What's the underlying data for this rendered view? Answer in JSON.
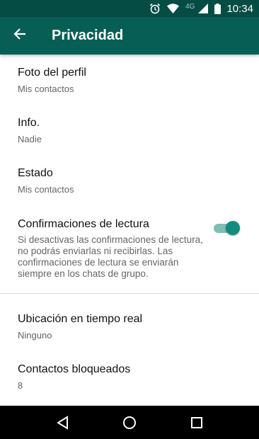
{
  "status_bar": {
    "network": "4G",
    "time": "10:34"
  },
  "app_bar": {
    "title": "Privacidad"
  },
  "settings": {
    "profile_photo": {
      "title": "Foto del perfil",
      "value": "Mis contactos"
    },
    "info": {
      "title": "Info.",
      "value": "Nadie"
    },
    "status": {
      "title": "Estado",
      "value": "Mis contactos"
    },
    "read_receipts": {
      "title": "Confirmaciones de lectura",
      "description": "Si desactivas las confirmaciones de lectura, no podrás enviarlas ni recibirlas. Las confirmaciones de lectura se enviarán siempre en los chats de grupo.",
      "enabled": true
    },
    "live_location": {
      "title": "Ubicación en tiempo real",
      "value": "Ninguno"
    },
    "blocked": {
      "title": "Contactos bloqueados",
      "value": "8"
    }
  },
  "colors": {
    "status_bar": "#054d44",
    "app_bar": "#075e54",
    "accent": "#128c7e"
  },
  "icons": [
    "alarm-icon",
    "wifi-icon",
    "signal-icon",
    "battery-icon",
    "back-arrow-icon",
    "nav-back-icon",
    "nav-home-icon",
    "nav-recents-icon"
  ]
}
